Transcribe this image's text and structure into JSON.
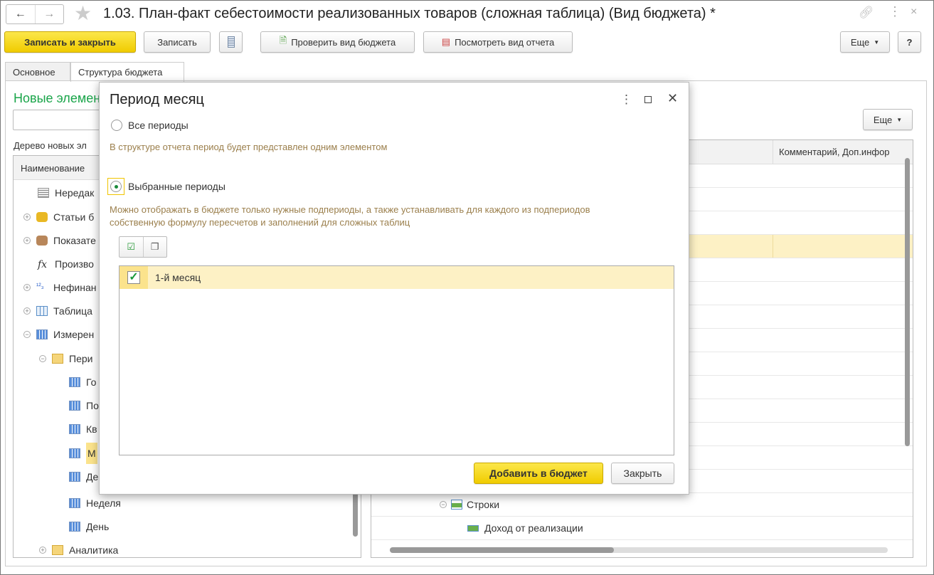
{
  "window": {
    "title": "1.03. План-факт себестоимости реализованных товаров (сложная таблица) (Вид бюджета) *",
    "back": "←",
    "forward": "→"
  },
  "toolbar": {
    "save_close": "Записать и закрыть",
    "save": "Записать",
    "check": "Проверить вид бюджета",
    "view_report": "Посмотреть вид отчета",
    "more": "Еще",
    "help": "?"
  },
  "tabs": [
    {
      "label": "Основное"
    },
    {
      "label": "Структура бюджета"
    }
  ],
  "left": {
    "section_title": "Новые элемен",
    "tree_label": "Дерево новых эл",
    "column": "Наименование",
    "items": [
      {
        "label": "Нередак"
      },
      {
        "label": "Статьи б"
      },
      {
        "label": "Показате"
      },
      {
        "label": "Произво"
      },
      {
        "label": "Нефинан"
      },
      {
        "label": "Таблица"
      },
      {
        "label": "Измерен"
      },
      {
        "label": "Пери"
      },
      {
        "label": "Го"
      },
      {
        "label": "По"
      },
      {
        "label": "Кв"
      },
      {
        "label": "М"
      },
      {
        "label": "Де"
      },
      {
        "label": "Неделя"
      },
      {
        "label": "День"
      },
      {
        "label": "Аналитика"
      }
    ]
  },
  "right": {
    "more": "Еще",
    "column_comment": "Комментарий, Доп.инфор",
    "rows": [
      {
        "label": "Строки"
      },
      {
        "label": "Доход от реализации"
      }
    ]
  },
  "dialog": {
    "title": "Период месяц",
    "option_all": "Все периоды",
    "hint_all": "В структуре отчета период будет представлен одним элементом",
    "option_selected": "Выбранные периоды",
    "hint_selected_1": "Можно отображать в бюджете только нужные подпериоды, а также устанавливать для каждого из подпериодов",
    "hint_selected_2": "собственную формулу пересчетов и заполнений для сложных таблиц",
    "periods": [
      {
        "label": "1-й месяц",
        "checked": true
      }
    ],
    "add": "Добавить в бюджет",
    "close": "Закрыть"
  },
  "colors": {
    "accent_yellow": "#f5d800",
    "selected_row": "#fdf1c5",
    "green_title": "#1aa54a",
    "hint": "#9b7f4c"
  }
}
